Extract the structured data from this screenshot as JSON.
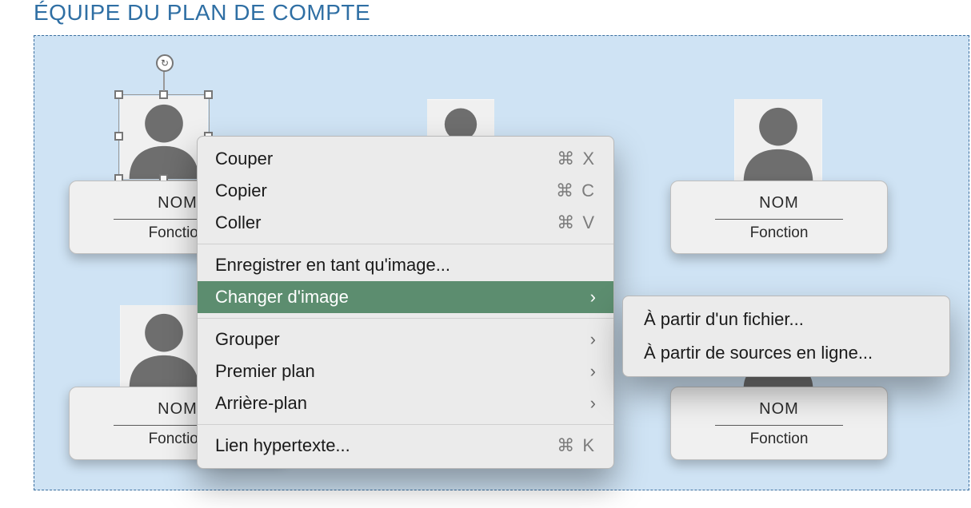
{
  "section_title": "ÉQUIPE DU PLAN DE COMPTE",
  "cards": {
    "c1": {
      "name": "NOM",
      "role": "Fonction"
    },
    "c2": {
      "name": "NOM",
      "role": "Fonction"
    },
    "c3": {
      "name": "NOM",
      "role": "Fonction"
    },
    "c4": {
      "name": "NOM",
      "role": "Fonction"
    }
  },
  "menu": {
    "cut": {
      "label": "Couper",
      "shortcut": "⌘ X"
    },
    "copy": {
      "label": "Copier",
      "shortcut": "⌘ C"
    },
    "paste": {
      "label": "Coller",
      "shortcut": "⌘ V"
    },
    "save_as_image": {
      "label": "Enregistrer en tant qu'image..."
    },
    "change_image": {
      "label": "Changer d'image"
    },
    "group": {
      "label": "Grouper"
    },
    "bring_front": {
      "label": "Premier plan"
    },
    "send_back": {
      "label": "Arrière-plan"
    },
    "hyperlink": {
      "label": "Lien hypertexte...",
      "shortcut": "⌘ K"
    }
  },
  "submenu": {
    "from_file": {
      "label": "À partir d'un fichier..."
    },
    "from_online": {
      "label": "À partir de sources en ligne..."
    }
  }
}
